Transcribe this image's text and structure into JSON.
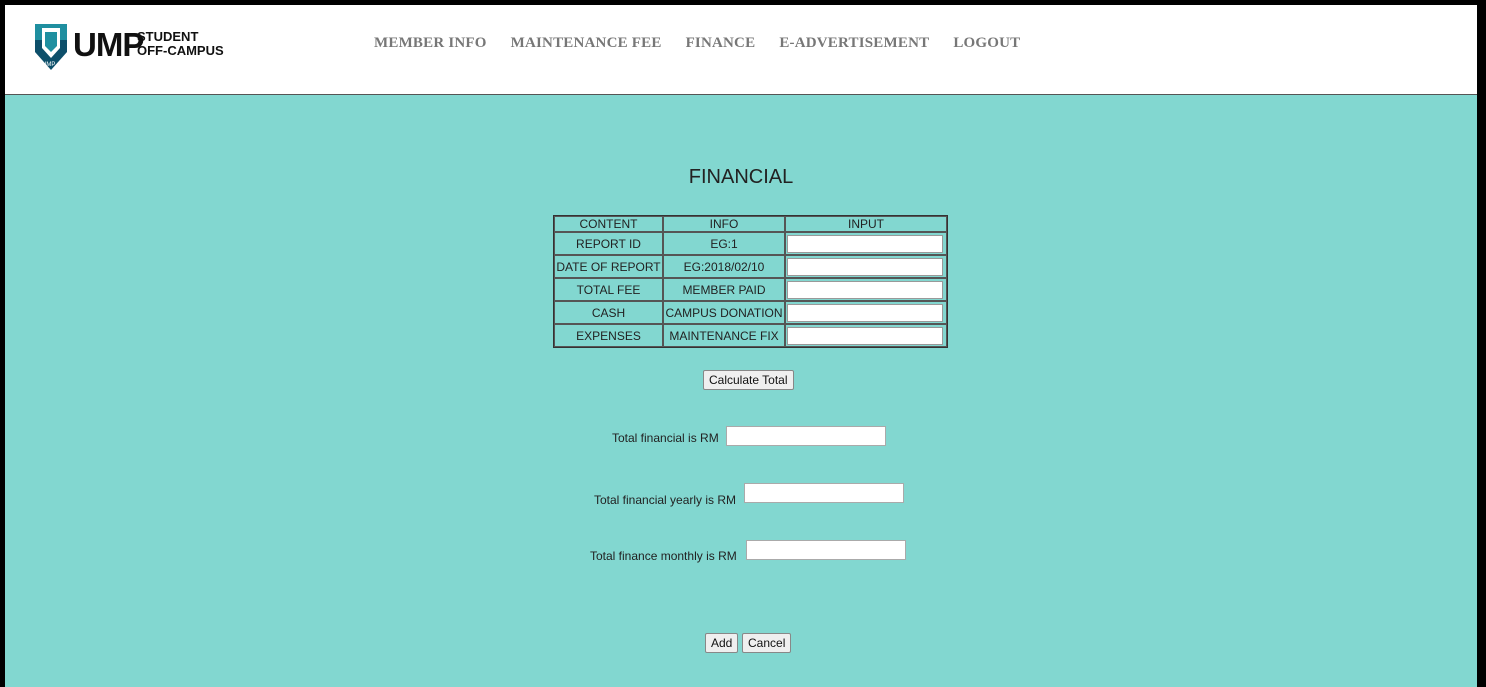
{
  "logo": {
    "main": "UMP",
    "line1": "STUDENT",
    "line2": "OFF-CAMPUS",
    "shield_text": "UMP"
  },
  "nav": [
    "MEMBER INFO",
    "MAINTENANCE FEE",
    "FINANCE",
    "E-ADVERTISEMENT",
    "LOGOUT"
  ],
  "page_title": "FINANCIAL",
  "table": {
    "headers": [
      "CONTENT",
      "INFO",
      "INPUT"
    ],
    "rows": [
      {
        "content": "REPORT ID",
        "info": "EG:1",
        "input": ""
      },
      {
        "content": "DATE OF REPORT",
        "info": "EG:2018/02/10",
        "input": ""
      },
      {
        "content": "TOTAL FEE",
        "info": "MEMBER PAID",
        "input": ""
      },
      {
        "content": "CASH",
        "info": "CAMPUS DONATION",
        "input": ""
      },
      {
        "content": "EXPENSES",
        "info": "MAINTENANCE FIX",
        "input": ""
      }
    ]
  },
  "calculate_label": "Calculate Total",
  "totals": {
    "total_label": "Total financial is RM",
    "total_value": "",
    "yearly_label": "Total financial yearly is RM",
    "yearly_value": "",
    "monthly_label": "Total finance monthly is RM",
    "monthly_value": ""
  },
  "actions": {
    "add": "Add",
    "cancel": "Cancel"
  },
  "colors": {
    "background": "#82d7d0",
    "shield_top": "#1f8fa0",
    "shield_bottom": "#0d4f6a",
    "nav_text": "#777777"
  }
}
